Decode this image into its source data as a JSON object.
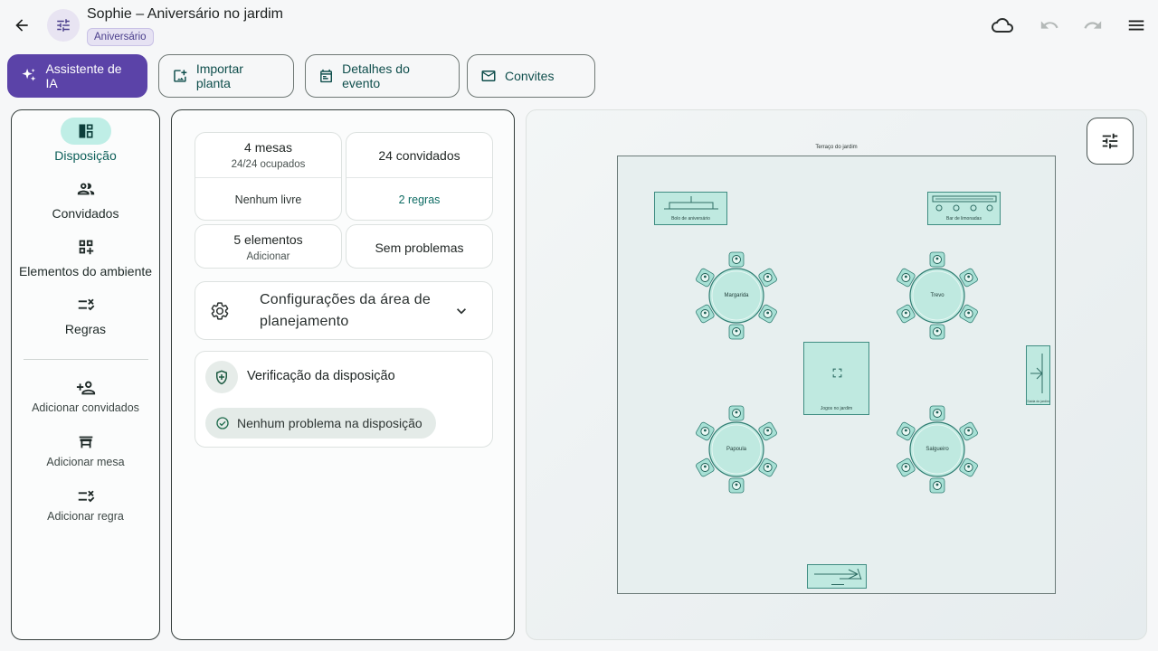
{
  "header": {
    "title": "Sophie – Aniversário no jardim",
    "tag": "Aniversário"
  },
  "toolbar": {
    "ai": "Assistente de IA",
    "import": "Importar planta",
    "details": "Detalhes do evento",
    "invites": "Convites"
  },
  "rail": {
    "layout": "Disposição",
    "guests": "Convidados",
    "elements": "Elementos do ambiente",
    "rules": "Regras",
    "add_guests": "Adicionar convidados",
    "add_table": "Adicionar mesa",
    "add_rule": "Adicionar regra"
  },
  "stats": {
    "tables": "4 mesas",
    "occupied": "24/24 ocupados",
    "free": "Nenhum livre",
    "guests": "24 convidados",
    "rules": "2 regras",
    "elements": "5 elementos",
    "add": "Adicionar",
    "problems": "Sem problemas"
  },
  "settings": {
    "label": "Configurações da área de planejamento"
  },
  "check": {
    "title": "Verificação da disposição",
    "status": "Nenhum problema na disposição"
  },
  "plan": {
    "title": "Terraço do jardim",
    "cake": "Bolo de aniversário",
    "bar": "Bar de limonadas",
    "games": "Jogos no jardim",
    "side": "Saída do jardim",
    "tables": [
      "Margarida",
      "Trevo",
      "Papoula",
      "Salgueiro"
    ]
  },
  "colors": {
    "primary": "#5b43a8",
    "accent": "#0d6b63",
    "table_fill": "#bfe9e0",
    "active_pill": "#bfeee6"
  }
}
